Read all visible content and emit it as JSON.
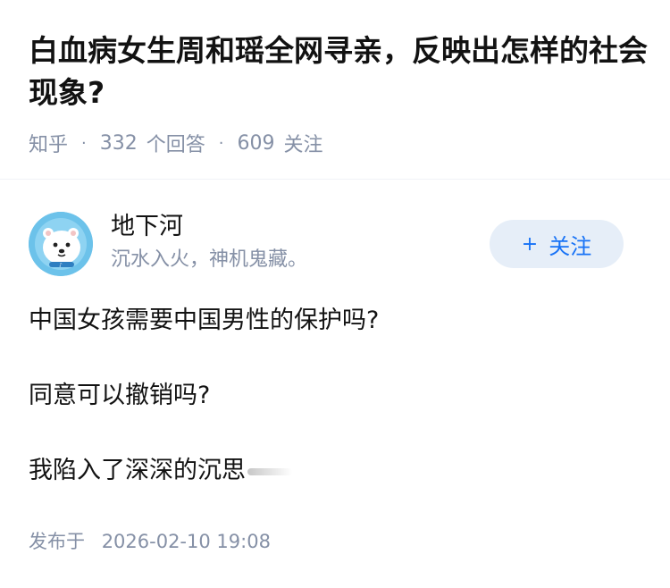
{
  "question": {
    "title": "白血病女生周和瑶全网寻亲，反映出怎样的社会现象?",
    "source": "知乎",
    "separator": "·",
    "answer_count": "332",
    "answer_label": "个回答",
    "follower_count": "609",
    "follower_label": "关注"
  },
  "author": {
    "name": "地下河",
    "bio": "沉水入火，神机鬼藏。",
    "avatar_icon": "polar-bear-avatar",
    "follow_plus": "+",
    "follow_label": "关注"
  },
  "answer": {
    "paragraphs": [
      "中国女孩需要中国男性的保护吗?",
      "同意可以撤销吗?",
      "我陷入了深深的沉思"
    ]
  },
  "footer": {
    "published_label": "发布于",
    "published_time": "2026-02-10 19:08"
  },
  "colors": {
    "text": "#121212",
    "meta": "#8590a6",
    "accent": "#1772f6",
    "follow_bg": "#e6eef8",
    "avatar_bg": "#6cc2ea"
  }
}
